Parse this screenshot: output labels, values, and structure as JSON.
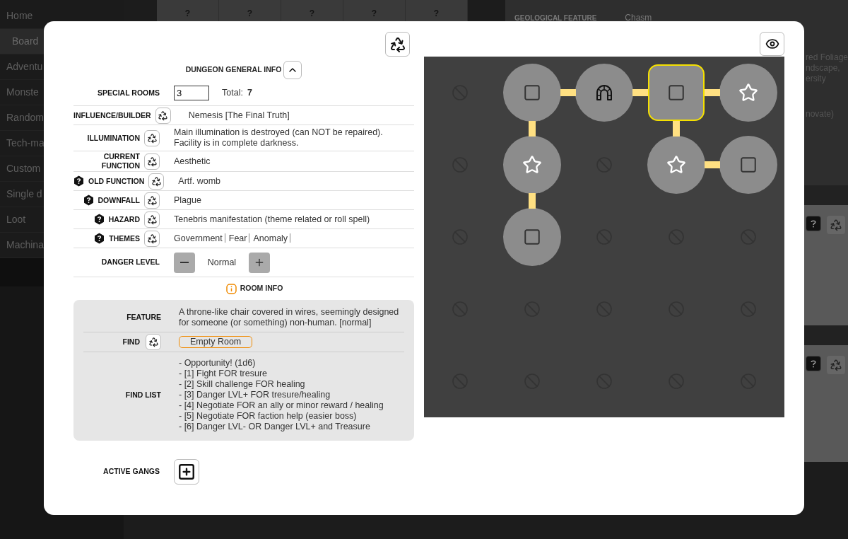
{
  "background": {
    "sidebar": [
      {
        "label": "Home",
        "selected": false
      },
      {
        "label": "Board",
        "selected": true
      },
      {
        "label": "Adventu",
        "selected": false
      },
      {
        "label": "Monste",
        "selected": false
      },
      {
        "label": "Random",
        "selected": false
      },
      {
        "label": "Tech-ma",
        "selected": false
      },
      {
        "label": "Custom",
        "selected": false
      },
      {
        "label": "Single d",
        "selected": false
      },
      {
        "label": "Loot",
        "selected": false
      },
      {
        "label": "Machina",
        "selected": false
      }
    ],
    "top_cells": [
      "?",
      "?",
      "?",
      "?",
      "?"
    ],
    "feature_label": "GEOLOGICAL FEATURE",
    "feature_value": "Chasm",
    "side_paragraphs": [
      [
        "red Foliage",
        "ndscape,",
        "ersity"
      ],
      [
        "novate)"
      ]
    ]
  },
  "general": {
    "title": "DUNGEON GENERAL INFO",
    "expanded": true,
    "special_rooms": {
      "label": "SPECIAL ROOMS",
      "value": "3",
      "total_label": "Total:",
      "total": "7"
    },
    "rows": [
      {
        "label": "INFLUENCE/BUILDER",
        "hint": false,
        "value": "Nemesis [The Final Truth]"
      },
      {
        "label": "ILLUMINATION",
        "hint": false,
        "value": "Main illumination is destroyed (can NOT be repaired). Facility is in complete darkness."
      },
      {
        "label": "CURRENT FUNCTION",
        "hint": false,
        "value": "Aesthetic"
      },
      {
        "label": "OLD FUNCTION",
        "hint": true,
        "value": "Artf. womb"
      },
      {
        "label": "DOWNFALL",
        "hint": true,
        "value": "Plague"
      },
      {
        "label": "HAZARD",
        "hint": true,
        "value": "Tenebris manifestation (theme related or roll spell)"
      },
      {
        "label": "THEMES",
        "hint": true,
        "themes": [
          "Government",
          "Fear",
          "Anomaly"
        ]
      }
    ],
    "danger": {
      "label": "DANGER LEVEL",
      "value": "Normal"
    }
  },
  "room": {
    "title": "ROOM INFO",
    "feature_label": "FEATURE",
    "feature": "A throne-like chair covered in wires, seemingly designed for someone (or something) non-human. [normal]",
    "find_label": "FIND",
    "find": "Empty Room",
    "list_label": "FIND LIST",
    "list": [
      "- Opportunity! (1d6)",
      "- [1] Fight FOR tresure",
      "- [2] Skill challenge FOR healing",
      "- [3] Danger LVL+ FOR tresure/healing",
      "- [4] Negotiate FOR an ally or minor reward / healing",
      "- [5] Negotiate FOR faction help (easier boss)",
      "- [6] Danger LVL- OR Danger LVL+ and Treasure"
    ]
  },
  "gangs": {
    "label": "ACTIVE GANGS"
  },
  "map": {
    "rows": [
      [
        {
          "kind": "empty",
          "selected": false,
          "link_right": false,
          "link_down": false
        },
        {
          "kind": "room",
          "selected": false,
          "link_right": true,
          "link_down": true
        },
        {
          "kind": "entrance",
          "selected": false,
          "link_right": true,
          "link_down": false
        },
        {
          "kind": "room",
          "selected": true,
          "link_right": true,
          "link_down": true
        },
        {
          "kind": "star",
          "selected": false,
          "link_right": false,
          "link_down": false
        }
      ],
      [
        {
          "kind": "empty",
          "selected": false,
          "link_right": false,
          "link_down": false
        },
        {
          "kind": "star",
          "selected": false,
          "link_right": false,
          "link_down": true
        },
        {
          "kind": "empty",
          "selected": false,
          "link_right": false,
          "link_down": false
        },
        {
          "kind": "star",
          "selected": false,
          "link_right": true,
          "link_down": false
        },
        {
          "kind": "room",
          "selected": false,
          "link_right": false,
          "link_down": false
        }
      ],
      [
        {
          "kind": "empty",
          "selected": false,
          "link_right": false,
          "link_down": false
        },
        {
          "kind": "room",
          "selected": false,
          "link_right": false,
          "link_down": false
        },
        {
          "kind": "empty",
          "selected": false,
          "link_right": false,
          "link_down": false
        },
        {
          "kind": "empty",
          "selected": false,
          "link_right": false,
          "link_down": false
        },
        {
          "kind": "empty",
          "selected": false,
          "link_right": false,
          "link_down": false
        }
      ],
      [
        {
          "kind": "empty",
          "selected": false,
          "link_right": false,
          "link_down": false
        },
        {
          "kind": "empty",
          "selected": false,
          "link_right": false,
          "link_down": false
        },
        {
          "kind": "empty",
          "selected": false,
          "link_right": false,
          "link_down": false
        },
        {
          "kind": "empty",
          "selected": false,
          "link_right": false,
          "link_down": false
        },
        {
          "kind": "empty",
          "selected": false,
          "link_right": false,
          "link_down": false
        }
      ],
      [
        {
          "kind": "empty",
          "selected": false,
          "link_right": false,
          "link_down": false
        },
        {
          "kind": "empty",
          "selected": false,
          "link_right": false,
          "link_down": false
        },
        {
          "kind": "empty",
          "selected": false,
          "link_right": false,
          "link_down": false
        },
        {
          "kind": "empty",
          "selected": false,
          "link_right": false,
          "link_down": false
        },
        {
          "kind": "empty",
          "selected": false,
          "link_right": false,
          "link_down": false
        }
      ]
    ]
  }
}
